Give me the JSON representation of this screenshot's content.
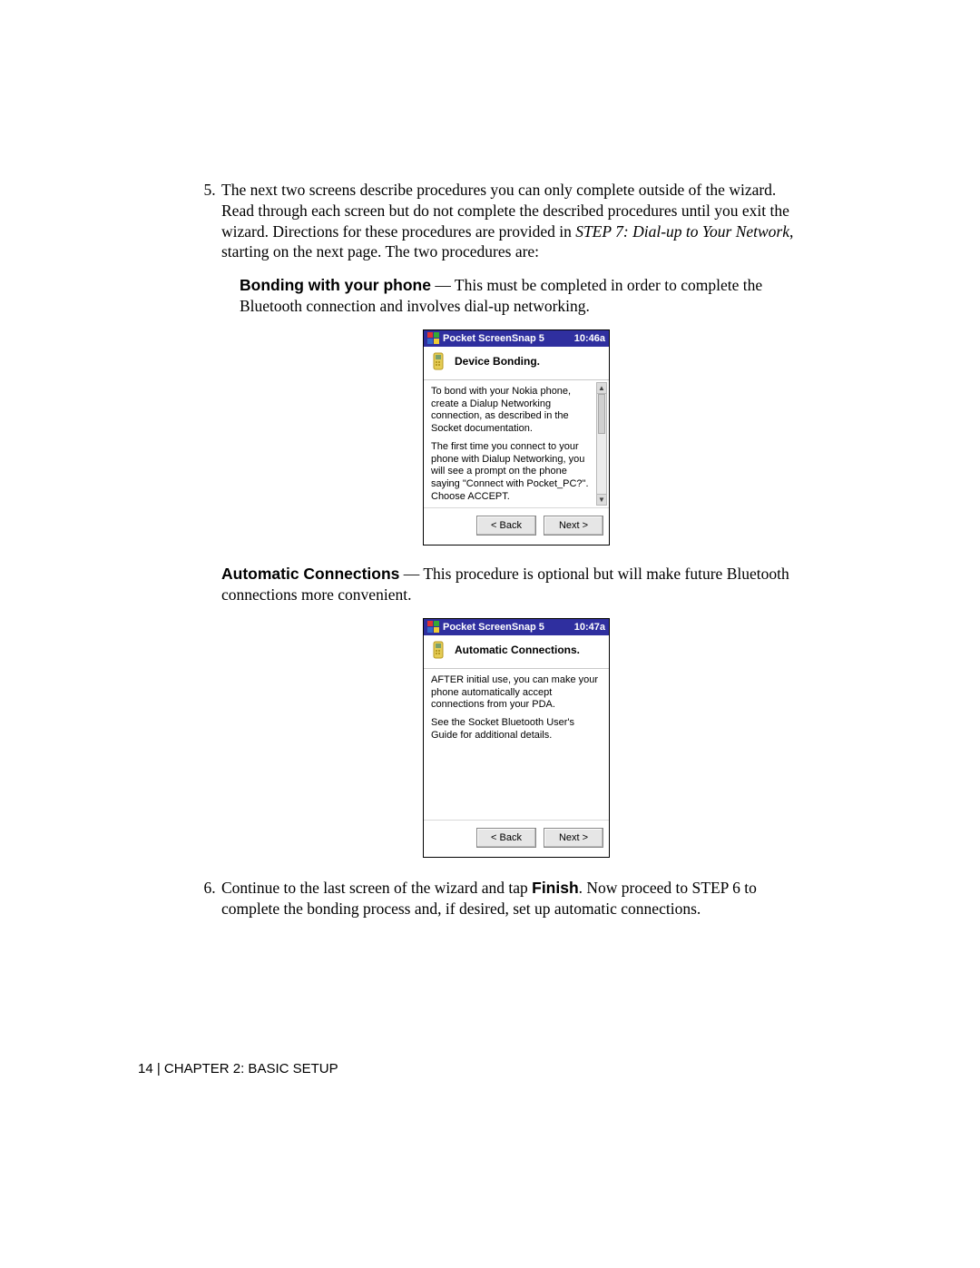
{
  "step5": {
    "number": "5.",
    "text_a": "The next two screens describe procedures you can only complete outside of the wizard. Read through each screen but do not complete the described procedures until you exit the wizard. Directions for these procedures are provided in ",
    "text_italic": "STEP 7: Dial-up to Your Network",
    "text_b": ", starting on the next page. The two procedures are:"
  },
  "bonding": {
    "label": "Bonding with your phone",
    "text": " — This must be completed in order to complete the Bluetooth connection and involves dial-up networking."
  },
  "auto": {
    "label": "Automatic Connections",
    "text": " — This procedure is optional but will make future Bluetooth connections more convenient."
  },
  "step6": {
    "number": "6.",
    "text_a": "Continue to the last screen of the wizard and tap ",
    "finish": "Finish",
    "text_b": ". Now proceed to STEP 6 to complete the bonding process and, if desired, set up automatic connections."
  },
  "pda1": {
    "title": "Pocket ScreenSnap 5",
    "time": "10:46a",
    "header": "Device Bonding.",
    "para1": "To bond with your Nokia phone, create a Dialup Networking connection, as described in the Socket documentation.",
    "para2": "The first time you connect to your phone with Dialup Networking, you will see a prompt on the phone saying \"Connect with Pocket_PC?\". Choose ACCEPT.",
    "back": "< Back",
    "next": "Next >"
  },
  "pda2": {
    "title": "Pocket ScreenSnap 5",
    "time": "10:47a",
    "header": "Automatic Connections.",
    "para1": "AFTER initial use, you can make your phone automatically accept connections from your PDA.",
    "para2": "See the Socket Bluetooth User's Guide for additional details.",
    "back": "< Back",
    "next": "Next >"
  },
  "footer": "14 | CHAPTER 2: BASIC SETUP"
}
